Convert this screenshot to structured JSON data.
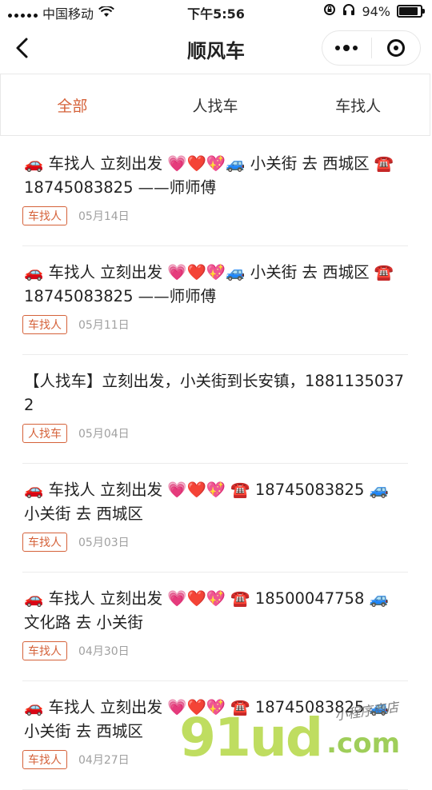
{
  "status_bar": {
    "carrier": "中国移动",
    "time": "下午5:56",
    "battery": "94%",
    "battery_level": 0.94
  },
  "nav": {
    "title": "顺风车"
  },
  "tabs": [
    {
      "label": "全部",
      "active": true
    },
    {
      "label": "人找车",
      "active": false
    },
    {
      "label": "车找人",
      "active": false
    }
  ],
  "posts": [
    {
      "text": "🚗 车找人 立刻出发 💗❤️💖🚙 小关街 去 西城区 ☎️ 18745083825 ——师师傅",
      "tag": "车找人",
      "date": "05月14日"
    },
    {
      "text": "🚗 车找人 立刻出发 💗❤️💖🚙 小关街 去 西城区 ☎️ 18745083825 ——师师傅",
      "tag": "车找人",
      "date": "05月11日"
    },
    {
      "text": "【人找车】立刻出发，小关街到长安镇，18811350372",
      "tag": "人找车",
      "date": "05月04日"
    },
    {
      "text": "🚗 车找人 立刻出发 💗❤️💖 ☎️ 18745083825 🚙 小关街 去 西城区",
      "tag": "车找人",
      "date": "05月03日"
    },
    {
      "text": "🚗 车找人 立刻出发 💗❤️💖 ☎️ 18500047758 🚙 文化路 去 小关街",
      "tag": "车找人",
      "date": "04月30日"
    },
    {
      "text": "🚗 车找人 立刻出发 💗❤️💖 ☎️ 18745083825 🚙 小关街 去 西城区",
      "tag": "车找人",
      "date": "04月27日"
    }
  ],
  "watermark": {
    "main": "91ud",
    "suffix": ".com",
    "script": "小程序商店"
  },
  "colors": {
    "accent": "#d5623a",
    "watermark_green": "#b5d845"
  }
}
